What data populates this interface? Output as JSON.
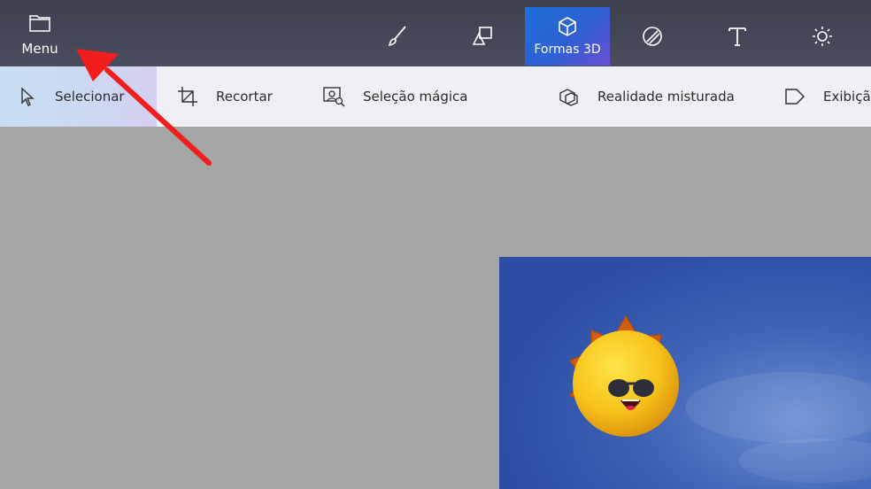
{
  "topbar": {
    "menu_label": "Menu",
    "tools": [
      {
        "icon": "brush-icon"
      },
      {
        "icon": "shapes-2d-icon"
      },
      {
        "icon": "cube-3d-icon",
        "label": "Formas 3D",
        "active": true
      },
      {
        "icon": "sticker-icon"
      },
      {
        "icon": "text-icon"
      },
      {
        "icon": "effects-icon"
      }
    ]
  },
  "secondary_toolbar": {
    "items": [
      {
        "label": "Selecionar",
        "icon": "select-cursor-icon",
        "selected": true
      },
      {
        "label": "Recortar",
        "icon": "crop-icon"
      },
      {
        "label": "Seleção mágica",
        "icon": "magic-select-icon"
      },
      {
        "label": "Realidade misturada",
        "icon": "mixed-reality-icon"
      },
      {
        "label": "Exibição",
        "icon": "view-3d-icon"
      }
    ]
  },
  "colors": {
    "topbar_bg": "#44475a",
    "active_tool": "#2e5fd3",
    "canvas_bg": "#a4a7a6",
    "annotation_arrow": "#f21d1d"
  }
}
